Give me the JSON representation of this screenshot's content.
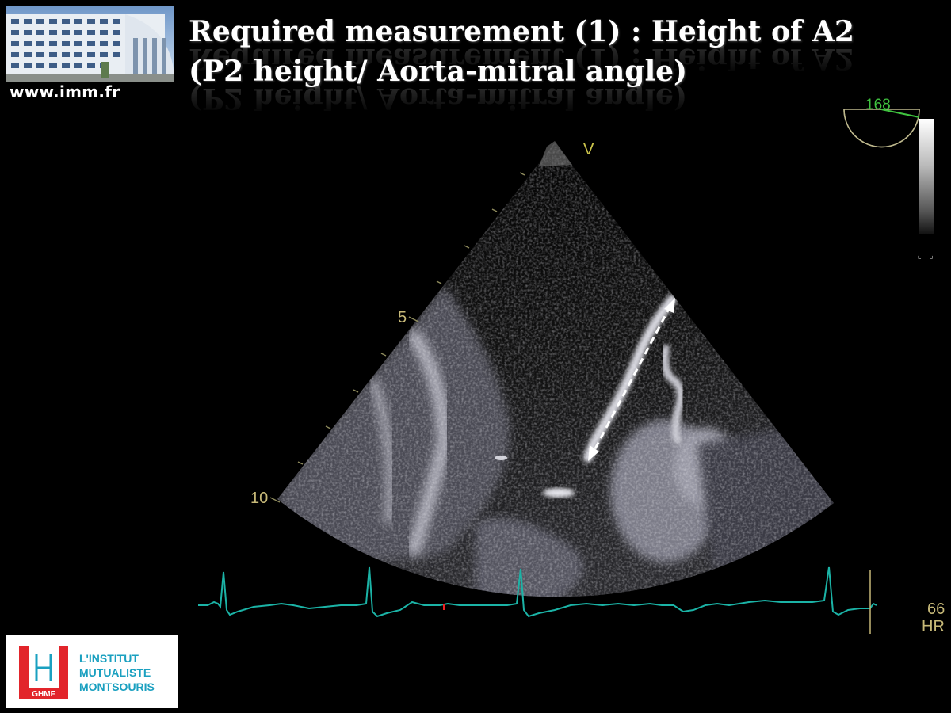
{
  "slide": {
    "site_url": "www.imm.fr",
    "title_line_1": "Required measurement (1) : Height of A2",
    "title_line_2": "(P2 height/ Aorta-mitral angle)"
  },
  "echo": {
    "depth_marker_5": "5",
    "depth_marker_10": "10",
    "probe_marker": "V",
    "angle_readout": "168",
    "heart_rate_value": "66",
    "heart_rate_label": "HR",
    "ecg_color": "#1bb3a6",
    "angle_color": "#3fc23f",
    "scale_text_color": "#c7b978"
  },
  "logo": {
    "mark_caption": "GHMF",
    "line_1": "L'INSTITUT",
    "line_2": "MUTUALISTE",
    "line_3": "MONTSOURIS",
    "brand_red": "#e2252b",
    "brand_teal": "#1aa0c0"
  }
}
